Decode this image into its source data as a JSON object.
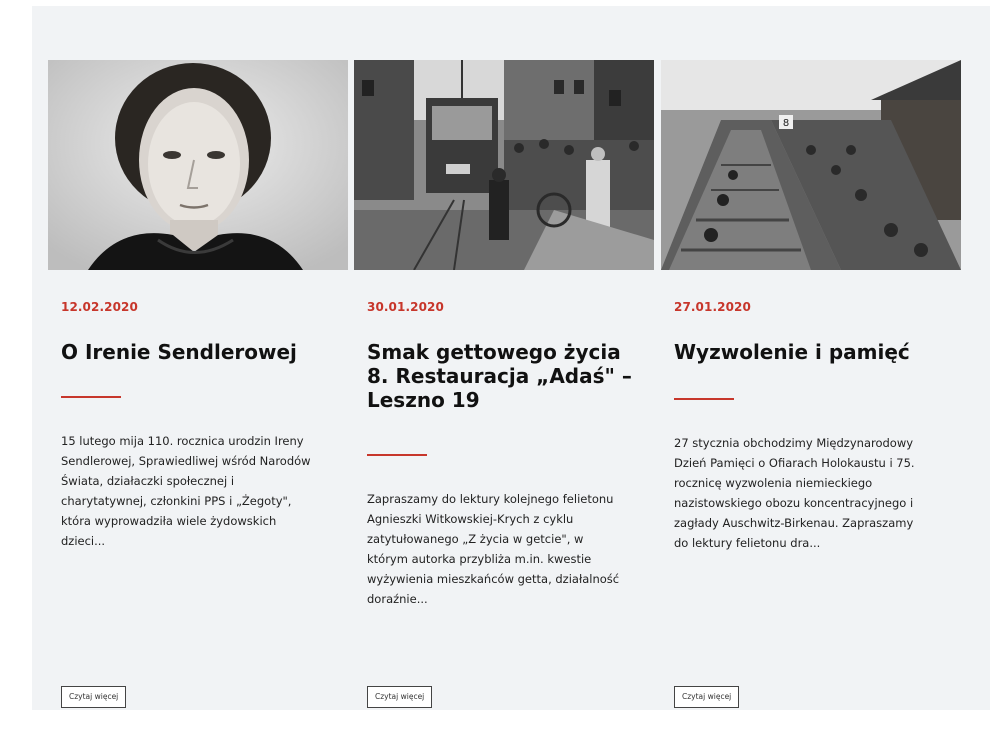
{
  "cards": [
    {
      "date": "12.02.2020",
      "title": "O Irenie Sendlerowej",
      "excerpt": "15 lutego mija 110. rocznica urodzin Ireny Sendlerowej, Sprawiedliwej wśród Narodów Świata, działaczki społecznej i charytatywnej, członkini PPS i „Żegoty\", która wyprowadziła wiele żydowskich dzieci...",
      "button": "Czytaj więcej"
    },
    {
      "date": "30.01.2020",
      "title": "Smak gettowego życia 8. Restauracja „Adaś\" – Leszno 19",
      "excerpt": "Zapraszamy do lektury kolejnego felietonu Agnieszki Witkowskiej-Krych z cyklu zatytułowanego „Z życia w getcie\", w którym autorka przybliża m.in. kwestie wyżywienia mieszkańców getta, działalność doraźnie...",
      "button": "Czytaj więcej"
    },
    {
      "date": "27.01.2020",
      "title": "Wyzwolenie i pamięć",
      "excerpt": "27 stycznia obchodzimy Międzynarodowy Dzień Pamięci o Ofiarach Holokaustu i 75. rocznicę wyzwolenia niemieckiego nazistowskiego obozu koncentracyjnego i zagłady Auschwitz-Birkenau. Zapraszamy do lektury felietonu dra...",
      "button": "Czytaj więcej"
    }
  ],
  "photo3_sign": "8"
}
